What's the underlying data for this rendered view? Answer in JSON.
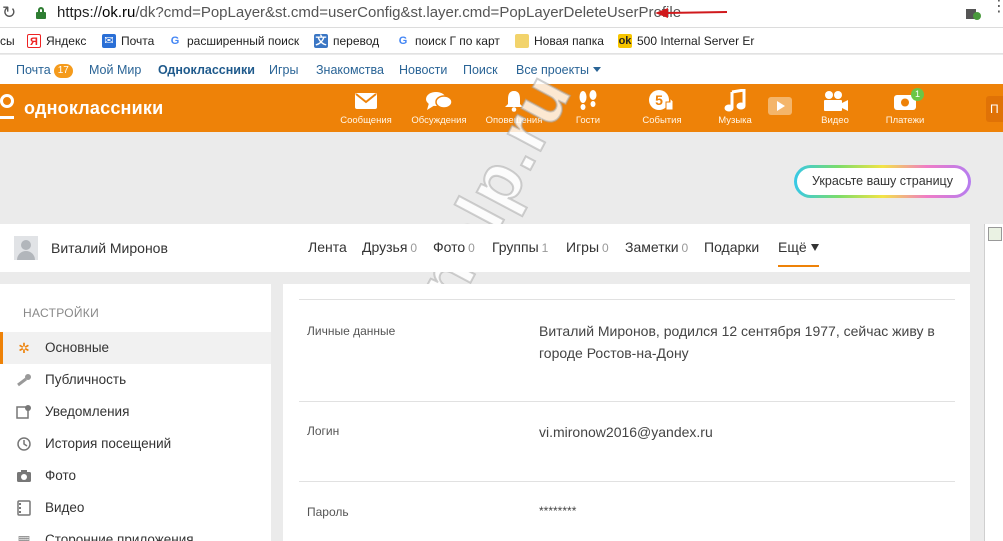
{
  "browser": {
    "url_scheme": "https://",
    "url_host": "ok.ru",
    "url_path": "/dk?cmd=PopLayer&st.cmd=userConfig&st.layer.cmd=PopLayerDeleteUserProfile",
    "bookmarks": [
      {
        "label": "сы",
        "icon": "none"
      },
      {
        "label": "Яндекс",
        "icon": "yandex-icon"
      },
      {
        "label": "Почта",
        "icon": "mail-icon"
      },
      {
        "label": "расширенный поиск",
        "icon": "google-icon"
      },
      {
        "label": "перевод",
        "icon": "translate-icon"
      },
      {
        "label": "поиск Г по карт",
        "icon": "google-icon"
      },
      {
        "label": "Новая папка",
        "icon": "folder-icon"
      },
      {
        "label": "500 Internal Server Er",
        "icon": "ok-icon"
      }
    ]
  },
  "portal_nav": {
    "items": [
      "Почта",
      "Мой Мир",
      "Одноклассники",
      "Игры",
      "Знакомства",
      "Новости",
      "Поиск",
      "Все проекты"
    ],
    "mail_badge": "17"
  },
  "header": {
    "logo_text": "одноклассники",
    "tools": [
      {
        "label": "Сообщения",
        "icon": "envelope-icon"
      },
      {
        "label": "Обсуждения",
        "icon": "chat-bubbles-icon"
      },
      {
        "label": "Оповещения",
        "icon": "bell-icon"
      },
      {
        "label": "Гости",
        "icon": "footprints-icon"
      },
      {
        "label": "События",
        "icon": "five-like-icon"
      },
      {
        "label": "Музыка",
        "icon": "music-note-icon"
      },
      {
        "label": "Видео",
        "icon": "video-camera-icon"
      },
      {
        "label": "Платежи",
        "icon": "payments-icon"
      }
    ],
    "payments_badge": "1",
    "right_button_letter": "П"
  },
  "decorate_button": "Украсьте вашу страницу",
  "profile": {
    "name": "Виталий Миронов",
    "tabs": [
      {
        "label": "Лента",
        "count": ""
      },
      {
        "label": "Друзья",
        "count": "0"
      },
      {
        "label": "Фото",
        "count": "0"
      },
      {
        "label": "Группы",
        "count": "1"
      },
      {
        "label": "Игры",
        "count": "0"
      },
      {
        "label": "Заметки",
        "count": "0"
      },
      {
        "label": "Подарки",
        "count": ""
      },
      {
        "label": "Ещё",
        "count": ""
      }
    ]
  },
  "sidebar": {
    "title": "НАСТРОЙКИ",
    "items": [
      {
        "label": "Основные",
        "icon": "gear-icon"
      },
      {
        "label": "Публичность",
        "icon": "key-icon"
      },
      {
        "label": "Уведомления",
        "icon": "notification-icon"
      },
      {
        "label": "История посещений",
        "icon": "history-icon"
      },
      {
        "label": "Фото",
        "icon": "camera-icon"
      },
      {
        "label": "Видео",
        "icon": "video-icon"
      },
      {
        "label": "Сторонние приложения",
        "icon": "apps-icon"
      }
    ]
  },
  "settings": {
    "personal_label": "Личные данные",
    "personal_value": "Виталий Миронов, родился 12 сентября 1977, сейчас живу в городе Ростов-на-Дону",
    "login_label": "Логин",
    "login_value": "vi.mironow2016@yandex.ru",
    "password_label": "Пароль",
    "password_value": "********"
  },
  "watermark": "odnelp.ru",
  "colors": {
    "brand_orange": "#ee8208",
    "link_blue": "#2a6496",
    "arrow_red": "#d0191c"
  }
}
